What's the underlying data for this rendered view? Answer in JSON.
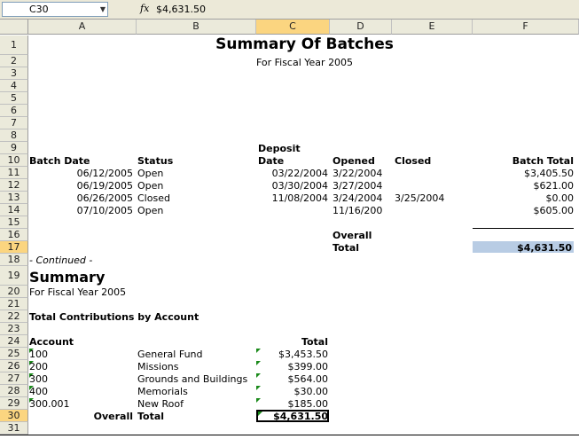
{
  "formula_bar": {
    "cell_ref": "C30",
    "fx": "fx",
    "value": "$4,631.50"
  },
  "columns": [
    "A",
    "B",
    "C",
    "D",
    "E",
    "F"
  ],
  "rows": [
    "1",
    "2",
    "3",
    "4",
    "5",
    "6",
    "7",
    "8",
    "9",
    "10",
    "11",
    "12",
    "13",
    "14",
    "15",
    "16",
    "17",
    "18",
    "19",
    "20",
    "21",
    "22",
    "23",
    "24",
    "25",
    "26",
    "27",
    "28",
    "29",
    "30",
    "31"
  ],
  "report": {
    "title": "Summary Of Batches",
    "subtitle": "For Fiscal Year 2005",
    "headers": {
      "batch_date": "Batch Date",
      "status": "Status",
      "deposit": "Deposit",
      "date": "Date",
      "opened": "Opened",
      "closed": "Closed",
      "batch_total": "Batch Total"
    },
    "batches": [
      {
        "batch_date": "06/12/2005",
        "status": "Open",
        "deposit_date": "03/22/2004",
        "opened": "3/22/2004",
        "closed": "",
        "total": "$3,405.50"
      },
      {
        "batch_date": "06/19/2005",
        "status": "Open",
        "deposit_date": "03/30/2004",
        "opened": "3/27/2004",
        "closed": "",
        "total": "$621.00"
      },
      {
        "batch_date": "06/26/2005",
        "status": "Closed",
        "deposit_date": "11/08/2004",
        "opened": "3/24/2004",
        "closed": "3/25/2004",
        "total": "$0.00"
      },
      {
        "batch_date": "07/10/2005",
        "status": "Open",
        "deposit_date": "",
        "opened": "11/16/200",
        "closed": "",
        "total": "$605.00"
      }
    ],
    "overall": "Overall",
    "total_label": "Total",
    "overall_total": "$4,631.50",
    "continued": "- Continued -",
    "summary_title": "Summary",
    "summary_subtitle": "For Fiscal Year 2005",
    "contrib_heading": "Total Contributions by Account",
    "account_header": "Account",
    "total_header": "Total",
    "accounts": [
      {
        "account": "100",
        "name": "General Fund",
        "total": "$3,453.50"
      },
      {
        "account": "200",
        "name": "Missions",
        "total": "$399.00"
      },
      {
        "account": "300",
        "name": "Grounds and Buildings",
        "total": "$564.00"
      },
      {
        "account": "400",
        "name": "Memorials",
        "total": "$30.00"
      },
      {
        "account": "300.001",
        "name": "New Roof",
        "total": "$185.00"
      }
    ],
    "summary_overall": "Overall",
    "summary_total_label": "Total",
    "summary_total": "$4,631.50"
  },
  "colors": {
    "header_bg": "#ebeadb",
    "selected_header": "#fbd580",
    "total_highlight": "#b8cce4",
    "error_triangle": "#1a8a1a"
  }
}
